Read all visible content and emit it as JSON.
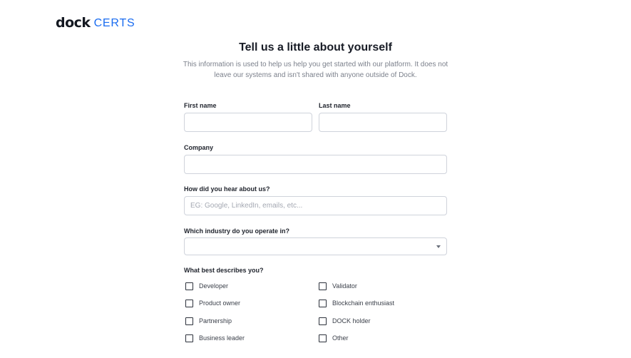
{
  "brand": {
    "dock": "dock",
    "certs": "CERTS",
    "accent_color": "#1a6cf0"
  },
  "header": {
    "title": "Tell us a little about yourself",
    "subtitle_line1": "This information is used to help us help you get started with our platform. It does not",
    "subtitle_line2": "leave our systems and isn't shared with anyone outside of Dock."
  },
  "form": {
    "first_name": {
      "label": "First name",
      "value": ""
    },
    "last_name": {
      "label": "Last name",
      "value": ""
    },
    "company": {
      "label": "Company",
      "value": ""
    },
    "hear_about": {
      "label": "How did you hear about us?",
      "value": "",
      "placeholder": "EG: Google, LinkedIn, emails, etc..."
    },
    "industry": {
      "label": "Which industry do you operate in?",
      "selected": ""
    },
    "describes": {
      "label": "What best describes you?",
      "options": [
        {
          "label": "Developer",
          "checked": false
        },
        {
          "label": "Validator",
          "checked": false
        },
        {
          "label": "Product owner",
          "checked": false
        },
        {
          "label": "Blockchain enthusiast",
          "checked": false
        },
        {
          "label": "Partnership",
          "checked": false
        },
        {
          "label": "DOCK holder",
          "checked": false
        },
        {
          "label": "Business leader",
          "checked": false
        },
        {
          "label": "Other",
          "checked": false
        }
      ]
    }
  }
}
